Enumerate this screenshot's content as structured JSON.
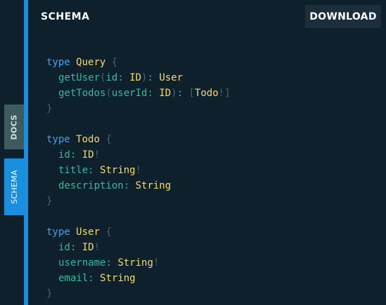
{
  "tabs": {
    "docs_label": "DOCS",
    "schema_label": "SCHEMA"
  },
  "panel": {
    "title": "SCHEMA",
    "download_label": "DOWNLOAD"
  },
  "schema": {
    "query": {
      "keyword": "type",
      "name": "Query",
      "open": "{",
      "close": "}",
      "getUser": {
        "name": "getUser",
        "open_paren": "(",
        "arg": "id",
        "colon1": ":",
        "arg_type": "ID",
        "close_paren": ")",
        "colon2": ":",
        "return_type": "User"
      },
      "getTodos": {
        "name": "getTodos",
        "open_paren": "(",
        "arg": "userId",
        "colon1": ":",
        "arg_type": "ID",
        "close_paren": ")",
        "colon2": ":",
        "list_open": "[",
        "return_type": "Todo",
        "bang": "!",
        "list_close": "]"
      }
    },
    "todo": {
      "keyword": "type",
      "name": "Todo",
      "open": "{",
      "close": "}",
      "fields": [
        {
          "name": "id",
          "colon": ":",
          "type": "ID",
          "bang": "!"
        },
        {
          "name": "title",
          "colon": ":",
          "type": "String",
          "bang": "!"
        },
        {
          "name": "description",
          "colon": ":",
          "type": "String",
          "bang": ""
        }
      ]
    },
    "user": {
      "keyword": "type",
      "name": "User",
      "open": "{",
      "close": "}",
      "fields": [
        {
          "name": "id",
          "colon": ":",
          "type": "ID",
          "bang": "!"
        },
        {
          "name": "username",
          "colon": ":",
          "type": "String",
          "bang": "!"
        },
        {
          "name": "email",
          "colon": ":",
          "type": "String",
          "bang": ""
        }
      ]
    }
  },
  "colors": {
    "background": "#0f202d",
    "accent": "#1a8fdf",
    "keyword": "#3aa3f0",
    "type_name": "#f2dc6e",
    "field": "#2bbd9f",
    "punctuation": "#48636b"
  }
}
